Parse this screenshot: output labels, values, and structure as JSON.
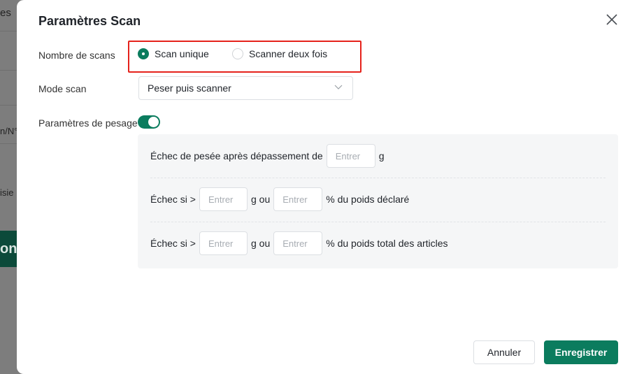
{
  "background": {
    "fragment_1": "es",
    "fragment_2": "n/N°",
    "fragment_3": "isie",
    "fragment_4": "onfi"
  },
  "dialog": {
    "title": "Paramètres Scan",
    "close_icon": "close-icon",
    "scan_count": {
      "label": "Nombre de scans",
      "options": [
        {
          "label": "Scan unique",
          "checked": true
        },
        {
          "label": "Scanner deux fois",
          "checked": false
        }
      ]
    },
    "scan_mode": {
      "label": "Mode scan",
      "value": "Peser puis scanner"
    },
    "weighing": {
      "label": "Paramètres de pesage",
      "enabled": true,
      "rule_1": {
        "prefix": "Échec de pesée après dépassement de",
        "placeholder": "Entrer",
        "unit": "g"
      },
      "rule_2": {
        "prefix": "Échec si >",
        "placeholder_g": "Entrer",
        "or_text": "g ou",
        "placeholder_pct": "Entrer",
        "suffix": "% du poids déclaré"
      },
      "rule_3": {
        "prefix": "Échec si >",
        "placeholder_g": "Entrer",
        "or_text": "g ou",
        "placeholder_pct": "Entrer",
        "suffix": "% du poids total des articles"
      }
    },
    "footer": {
      "cancel_label": "Annuler",
      "save_label": "Enregistrer"
    }
  },
  "colors": {
    "primary": "#0b7c5e",
    "highlight": "#e5221b",
    "overlay": "#8a8a8a"
  }
}
